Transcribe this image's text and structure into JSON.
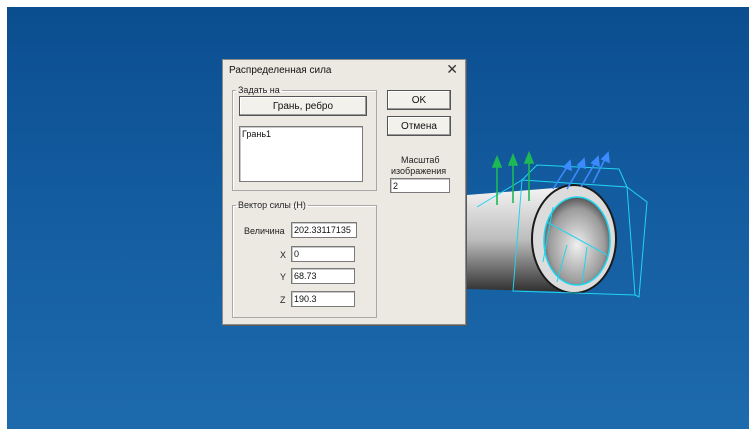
{
  "dialog": {
    "title": "Распределенная сила",
    "close_glyph": "✕",
    "apply_group": {
      "legend": "Задать на",
      "mode_button": "Грань, ребро",
      "list_items": [
        "Грань1"
      ]
    },
    "ok_label": "OK",
    "cancel_label": "Отмена",
    "scale": {
      "label_line1": "Масштаб",
      "label_line2": "изображения",
      "value": "2"
    },
    "vector_group": {
      "legend": "Вектор силы (Н)",
      "magnitude_label": "Величина",
      "magnitude_value": "202.33117135",
      "x_label": "X",
      "x_value": "0",
      "y_label": "Y",
      "y_value": "68.73",
      "z_label": "Z",
      "z_value": "190.3"
    }
  },
  "colors": {
    "viewport_top": "#0b4e90",
    "viewport_bottom": "#1d6aac",
    "highlight_cyan": "#22d3ee",
    "force_arrow_green": "#1db954",
    "force_arrow_blue": "#3b8bff"
  },
  "icons": {
    "close": "close-icon"
  }
}
